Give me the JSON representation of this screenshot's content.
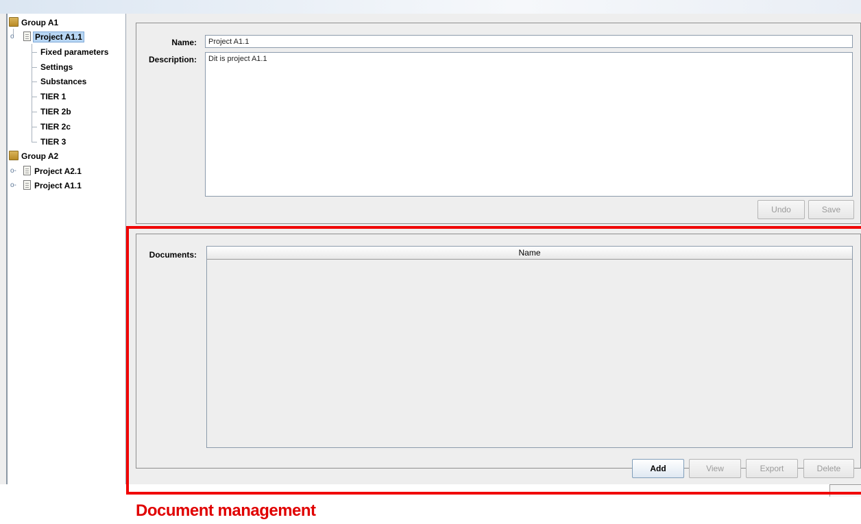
{
  "tree": {
    "groups": [
      {
        "label": "Group A1",
        "projects": [
          {
            "label": "Project A1.1",
            "selected": true,
            "expanded": true,
            "children": [
              "Fixed parameters",
              "Settings",
              "Substances",
              "TIER 1",
              "TIER 2b",
              "TIER 2c",
              "TIER 3"
            ]
          }
        ]
      },
      {
        "label": "Group A2",
        "projects": [
          {
            "label": "Project A2.1",
            "selected": false,
            "expanded": false
          },
          {
            "label": "Project A1.1",
            "selected": false,
            "expanded": false
          }
        ]
      }
    ]
  },
  "project_form": {
    "name_label": "Name:",
    "name_value": "Project A1.1",
    "description_label": "Description:",
    "description_value": "Dit is project A1.1",
    "undo_label": "Undo",
    "save_label": "Save"
  },
  "documents": {
    "label": "Documents:",
    "column_name": "Name",
    "rows": [],
    "add_label": "Add",
    "view_label": "View",
    "export_label": "Export",
    "delete_label": "Delete"
  },
  "annotation": {
    "caption": "Document management",
    "color": "#e00000"
  }
}
